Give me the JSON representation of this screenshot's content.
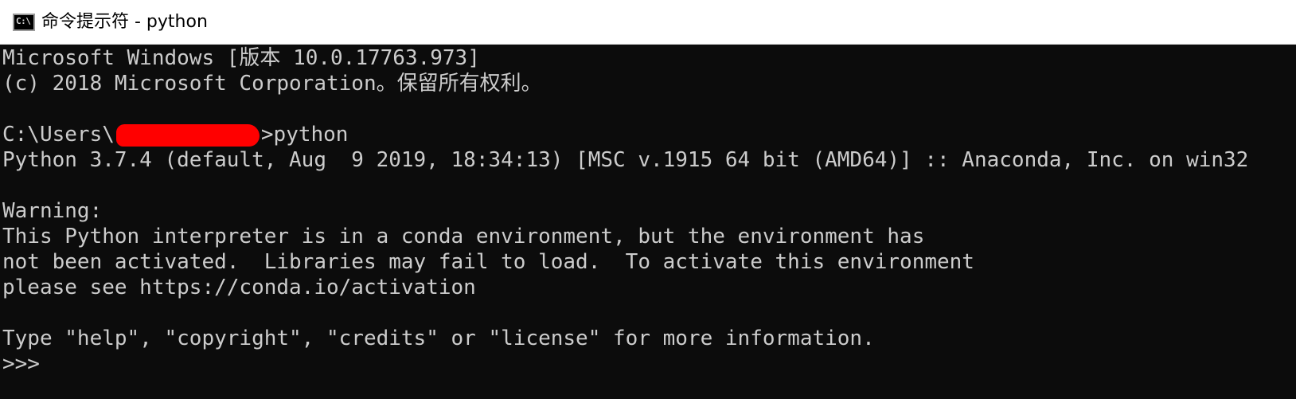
{
  "window": {
    "title": "命令提示符 - python",
    "icon": "cmd-icon",
    "icon_glyph": "C:\\"
  },
  "console": {
    "lines": [
      "Microsoft Windows [版本 10.0.17763.973]",
      "(c) 2018 Microsoft Corporation。保留所有权利。",
      "",
      "",
      "Python 3.7.4 (default, Aug  9 2019, 18:34:13) [MSC v.1915 64 bit (AMD64)] :: Anaconda, Inc. on win32",
      "",
      "Warning:",
      "This Python interpreter is in a conda environment, but the environment has",
      "not been activated.  Libraries may fail to load.  To activate this environment",
      "please see https://conda.io/activation",
      "",
      "Type \"help\", \"copyright\", \"credits\" or \"license\" for more information.",
      ">>>"
    ],
    "prompt_prefix": "C:\\Users\\",
    "prompt_command": ">python"
  },
  "colors": {
    "background": "#0c0c0c",
    "foreground": "#cccccc",
    "redaction": "#ff0000"
  }
}
